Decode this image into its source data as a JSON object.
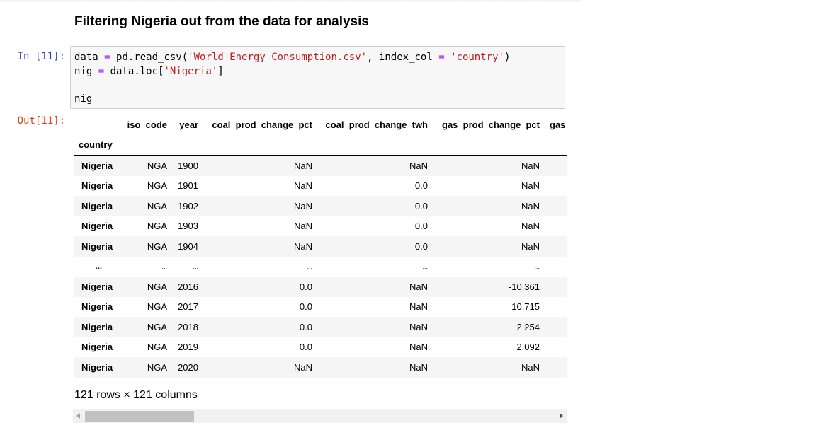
{
  "markdown": {
    "heading": "Filtering Nigeria out from the data for analysis"
  },
  "cell": {
    "in_prompt": "In [11]:",
    "out_prompt": "Out[11]:",
    "code": {
      "line1": {
        "var": "data",
        "eq": "=",
        "call": "pd.read_csv(",
        "str1": "'World Energy Consumption.csv'",
        "sep": ", index_col ",
        "eq2": "=",
        "str2": "'country'",
        "close": ")"
      },
      "line2": {
        "var": "nig",
        "eq": "=",
        "call": "data.loc[",
        "str": "'Nigeria'",
        "close": "]"
      },
      "line4": "nig"
    }
  },
  "dataframe": {
    "columns": [
      "iso_code",
      "year",
      "coal_prod_change_pct",
      "coal_prod_change_twh",
      "gas_prod_change_pct",
      "gas_"
    ],
    "index_name": "country",
    "rows": [
      {
        "index": "Nigeria",
        "cells": [
          "NGA",
          "1900",
          "NaN",
          "NaN",
          "NaN",
          ""
        ]
      },
      {
        "index": "Nigeria",
        "cells": [
          "NGA",
          "1901",
          "NaN",
          "0.0",
          "NaN",
          ""
        ]
      },
      {
        "index": "Nigeria",
        "cells": [
          "NGA",
          "1902",
          "NaN",
          "0.0",
          "NaN",
          ""
        ]
      },
      {
        "index": "Nigeria",
        "cells": [
          "NGA",
          "1903",
          "NaN",
          "0.0",
          "NaN",
          ""
        ]
      },
      {
        "index": "Nigeria",
        "cells": [
          "NGA",
          "1904",
          "NaN",
          "0.0",
          "NaN",
          ""
        ]
      },
      {
        "index": "...",
        "cells": [
          "...",
          "...",
          "...",
          "...",
          "...",
          ""
        ]
      },
      {
        "index": "Nigeria",
        "cells": [
          "NGA",
          "2016",
          "0.0",
          "NaN",
          "-10.361",
          ""
        ]
      },
      {
        "index": "Nigeria",
        "cells": [
          "NGA",
          "2017",
          "0.0",
          "NaN",
          "10.715",
          ""
        ]
      },
      {
        "index": "Nigeria",
        "cells": [
          "NGA",
          "2018",
          "0.0",
          "NaN",
          "2.254",
          ""
        ]
      },
      {
        "index": "Nigeria",
        "cells": [
          "NGA",
          "2019",
          "0.0",
          "NaN",
          "2.092",
          ""
        ]
      },
      {
        "index": "Nigeria",
        "cells": [
          "NGA",
          "2020",
          "NaN",
          "NaN",
          "NaN",
          ""
        ]
      }
    ],
    "shape_text": "121 rows × 121 columns"
  },
  "scrollbar": {
    "position": 0.0
  }
}
